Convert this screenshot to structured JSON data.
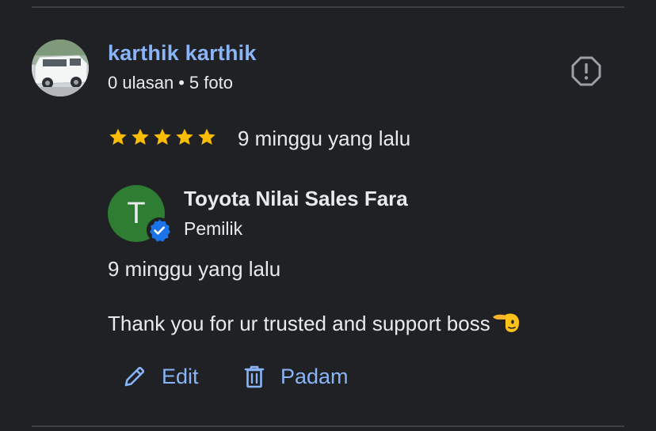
{
  "review": {
    "reviewer_name": "karthik karthik",
    "reviews_count": "0 ulasan",
    "meta_separator": "•",
    "photos_count": "5 foto",
    "rating": 5,
    "time_ago": "9 minggu yang lalu"
  },
  "icons": {
    "report": "report-icon",
    "star": "star-icon",
    "verified": "verified-badge-icon",
    "edit": "pencil-icon",
    "delete": "trash-icon"
  },
  "owner_reply": {
    "avatar_initial": "T",
    "name": "Toyota Nilai Sales Fara",
    "role": "Pemilik",
    "time_ago": "9 minggu yang lalu",
    "text": "Thank you for ur trusted and support boss"
  },
  "actions": {
    "edit_label": "Edit",
    "delete_label": "Padam"
  },
  "colors": {
    "background": "#202124",
    "link": "#8ab4f8",
    "star": "#fbbc04",
    "owner_avatar": "#2e7d32",
    "verified": "#1a73e8"
  }
}
